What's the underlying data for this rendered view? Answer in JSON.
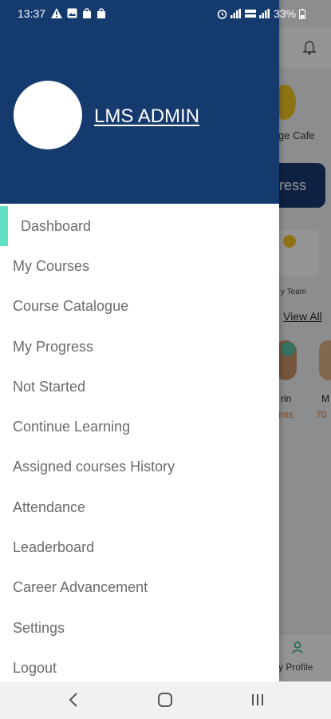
{
  "status_bar": {
    "time": "13:37",
    "battery": "33%"
  },
  "drawer": {
    "user_name": "LMS ADMIN",
    "menu": [
      {
        "label": "Dashboard",
        "active": true
      },
      {
        "label": "My Courses"
      },
      {
        "label": "Course Catalogue"
      },
      {
        "label": "My Progress"
      },
      {
        "label": "Not Started"
      },
      {
        "label": "Continue Learning"
      },
      {
        "label": "Assigned courses History"
      },
      {
        "label": "Attendance"
      },
      {
        "label": "Leaderboard"
      },
      {
        "label": "Career Advancement"
      },
      {
        "label": "Settings"
      },
      {
        "label": "Logout"
      }
    ]
  },
  "background": {
    "cafe_label": "ge Cafe",
    "progress_label": "ress",
    "team_label": "y Team",
    "view_all": "View All",
    "leader1_name": "rin",
    "leader1_points": "ints",
    "leader2_name": "M",
    "leader2_points": "70",
    "profile_label": "y Profile"
  },
  "colors": {
    "primary": "#153a6e",
    "accent": "#5fe0c5",
    "menu_text": "#6b6b6b"
  },
  "icons": {
    "status_left": [
      "warning-icon",
      "image-icon",
      "bag-icon",
      "bag-icon"
    ],
    "status_right": [
      "alarm-icon",
      "signal-icon",
      "volte-icon",
      "signal-icon",
      "battery-icon"
    ],
    "nav": [
      "back-icon",
      "home-icon",
      "recents-icon"
    ]
  }
}
